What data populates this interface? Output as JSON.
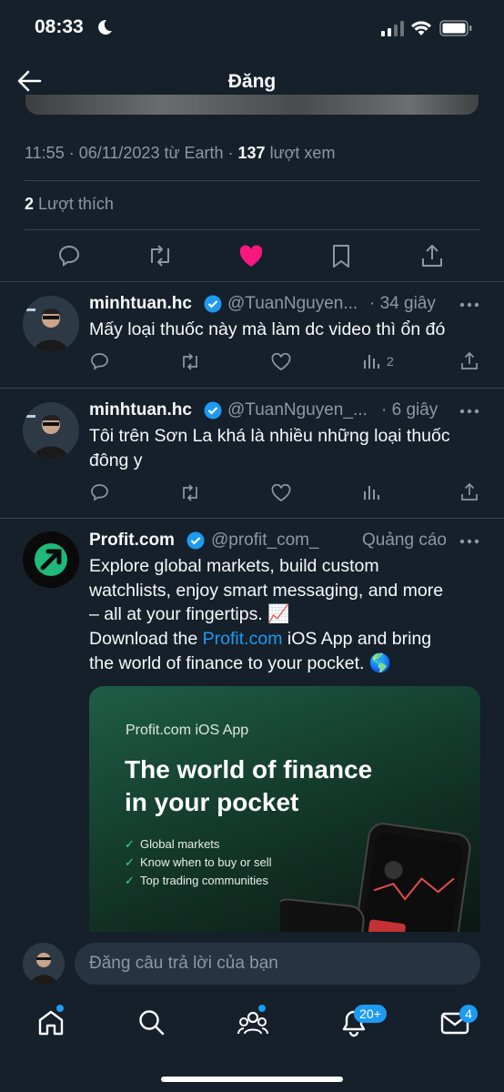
{
  "status_bar": {
    "time": "08:33"
  },
  "header": {
    "title": "Đăng"
  },
  "tweet_meta": {
    "prefix": "11:55 · 06/11/2023 từ Earth · ",
    "views": "137",
    "views_label": " lượt xem"
  },
  "likes": {
    "count": "2",
    "label": " Lượt thích"
  },
  "replies": [
    {
      "name": "minhtuan.hc",
      "handle": "@TuanNguyen...",
      "time": "· 34 giây",
      "text": "Mấy loại thuốc này mà làm dc video thì ổn đó",
      "views": "2"
    },
    {
      "name": "minhtuan.hc",
      "handle": "@TuanNguyen_...",
      "time": "· 6 giây",
      "text_line1": "Tôi trên Sơn La khá là nhiều những loại thuốc",
      "text_line2": "đông y",
      "views": ""
    }
  ],
  "ad": {
    "name": "Profit.com",
    "handle": "@profit_com_",
    "label": "Quảng cáo",
    "line1": "Explore global markets, build custom",
    "line2": "watchlists, enjoy smart messaging, and more",
    "line3": "– all at your fingertips. 📈",
    "line4_a": "Download the ",
    "line4_link": "Profit.com",
    "line4_b": " iOS App and bring",
    "line5": "the world of finance to your pocket. 🌎",
    "card": {
      "app_label": "Profit.com iOS App",
      "headline1": "The world of finance",
      "headline2": "in your pocket",
      "features": [
        "Global markets",
        "Know when to buy or sell",
        "Top trading communities"
      ]
    }
  },
  "reply_input": {
    "placeholder": "Đăng câu trả lời của bạn"
  },
  "tabbar": {
    "notifications_badge": "20+",
    "messages_badge": "4"
  },
  "colors": {
    "background": "#15202b",
    "accent": "#1d9bf0",
    "like": "#f91880",
    "muted": "#8b98a5"
  }
}
